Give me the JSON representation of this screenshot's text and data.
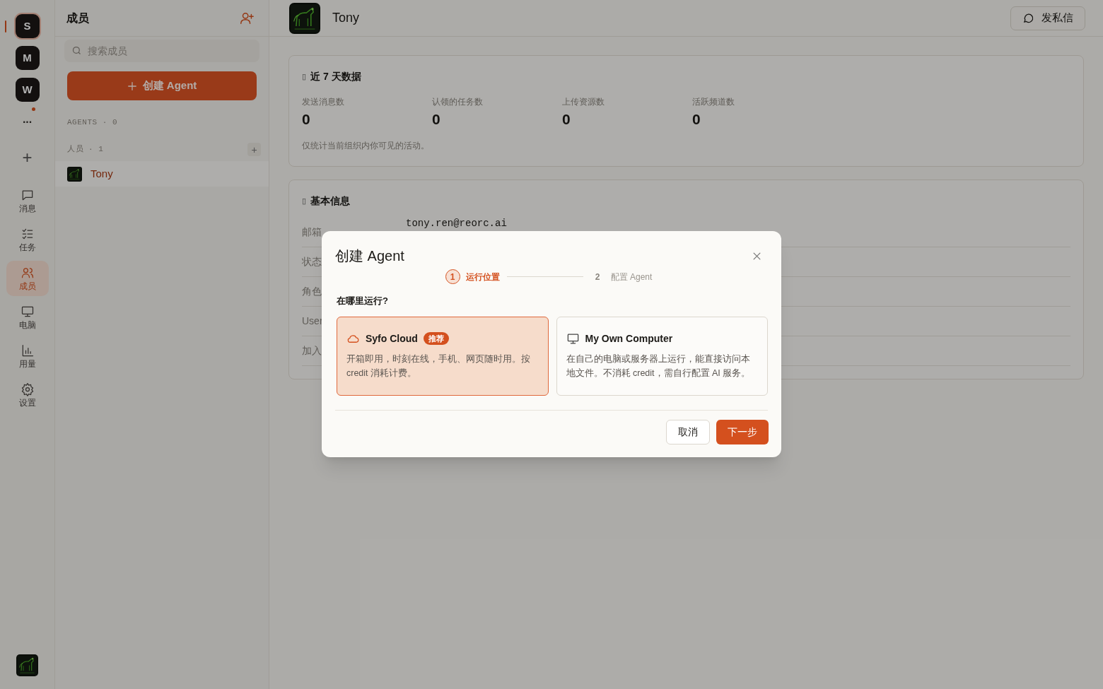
{
  "rail": {
    "workspaces": [
      {
        "letter": "S",
        "selected": true
      },
      {
        "letter": "M",
        "selected": false
      },
      {
        "letter": "W",
        "selected": false
      }
    ],
    "more": {
      "label": "···",
      "unread": true
    },
    "add": "+",
    "nav": [
      {
        "label": "消息",
        "selected": false
      },
      {
        "label": "任务",
        "selected": false
      },
      {
        "label": "成员",
        "selected": true
      },
      {
        "label": "电脑",
        "selected": false
      },
      {
        "label": "用量",
        "selected": false
      },
      {
        "label": "设置",
        "selected": false
      }
    ]
  },
  "members_panel": {
    "title": "成员",
    "search": {
      "placeholder": "搜索成员"
    },
    "create_button": "创建 Agent",
    "sections": [
      {
        "label": "AGENTS · 0"
      },
      {
        "label": "人员 · 1",
        "add_label": "+",
        "members": [
          {
            "name": "Tony",
            "selected": true
          }
        ]
      }
    ]
  },
  "header": {
    "name": "Tony",
    "dm_button": "发私信"
  },
  "stats_card": {
    "glyph": "▯",
    "title": "近 7 天数据",
    "stats": [
      {
        "label": "发送消息数",
        "value": "0"
      },
      {
        "label": "认领的任务数",
        "value": "0"
      },
      {
        "label": "上传资源数",
        "value": "0"
      },
      {
        "label": "活跃频道数",
        "value": "0"
      }
    ],
    "note": "仅统计当前组织内你可见的活动。"
  },
  "info_card": {
    "glyph": "▯",
    "title": "基本信息",
    "rows": [
      {
        "label": "邮箱",
        "value": "tony.ren@reorc.ai"
      },
      {
        "label": "状态"
      },
      {
        "label": "角色"
      },
      {
        "label": "User"
      },
      {
        "label": "加入"
      }
    ]
  },
  "dialog": {
    "title": "创建 Agent",
    "steps": [
      {
        "number": "1",
        "label": "运行位置",
        "selected": true
      },
      {
        "number": "2",
        "label": "配置 Agent",
        "selected": false
      }
    ],
    "question": "在哪里运行?",
    "options": [
      {
        "title": "Syfo Cloud",
        "badge": "推荐",
        "description": "开箱即用，时刻在线，手机、网页随时用。按 credit 消耗计费。",
        "selected": true
      },
      {
        "title": "My Own Computer",
        "description": "在自己的电脑或服务器上运行，能直接访问本地文件。不消耗 credit，需自行配置 AI 服务。",
        "selected": false
      }
    ],
    "cancel": "取消",
    "next": "下一步"
  }
}
